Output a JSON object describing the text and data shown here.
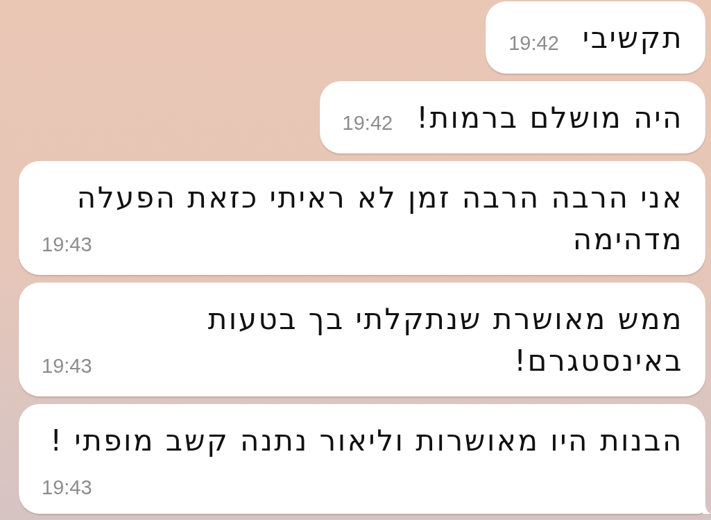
{
  "messages": [
    {
      "text": "תקשיבי",
      "time": "19:42",
      "tail": false
    },
    {
      "text": "היה מושלם ברמות!",
      "time": "19:42",
      "tail": false
    },
    {
      "text": "אני הרבה הרבה זמן לא ראיתי כזאת הפעלה מדהימה",
      "time": "19:43",
      "tail": false
    },
    {
      "text": "ממש מאושרת שנתקלתי בך בטעות באינסטגרם!",
      "time": "19:43",
      "tail": false
    },
    {
      "text": "הבנות היו מאושרות וליאור נתנה קשב מופתי !",
      "time": "19:43",
      "tail": true
    }
  ]
}
